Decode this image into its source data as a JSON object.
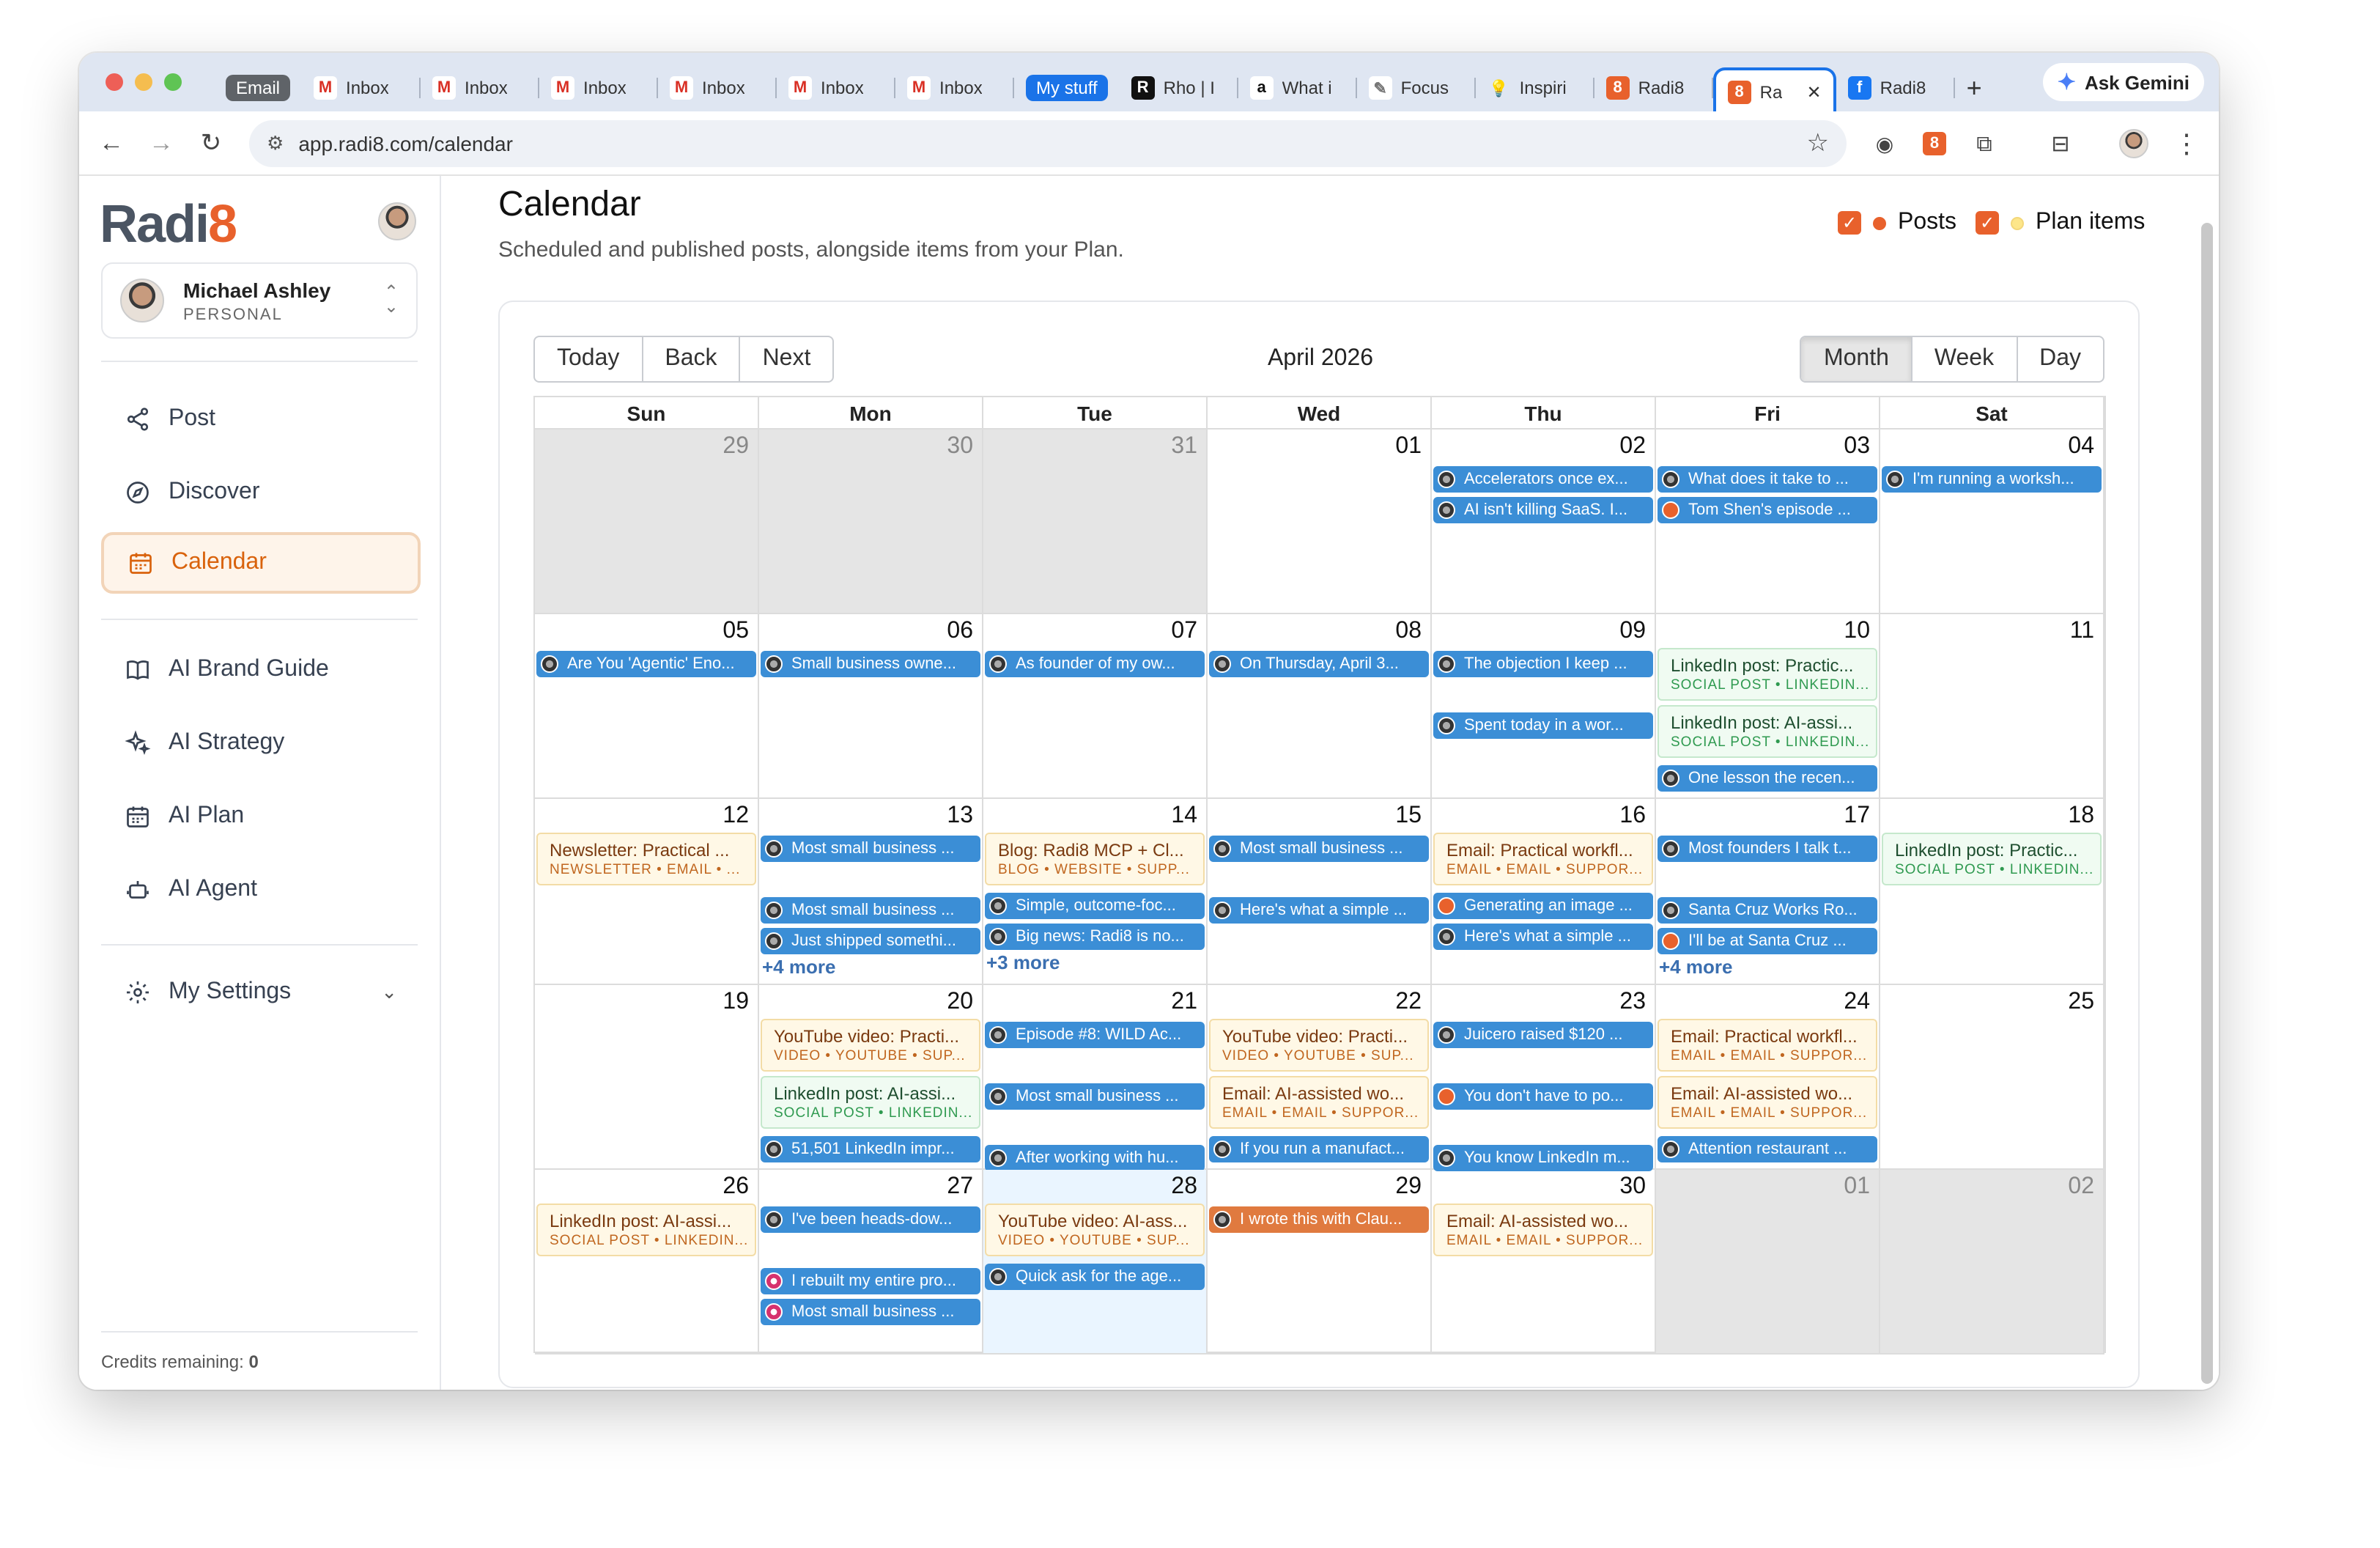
{
  "browser": {
    "tabs": [
      {
        "label": "Email",
        "kind": "group",
        "color": "#5f6368"
      },
      {
        "label": "Inbox",
        "icon": "gmail-icon"
      },
      {
        "label": "Inbox",
        "icon": "gmail-icon"
      },
      {
        "label": "Inbox",
        "icon": "gmail-icon"
      },
      {
        "label": "Inbox",
        "icon": "gmail-icon"
      },
      {
        "label": "Inbox",
        "icon": "gmail-icon"
      },
      {
        "label": "Inbox",
        "icon": "gmail-icon"
      },
      {
        "label": "My stuff",
        "kind": "group",
        "color": "#1a73e8"
      },
      {
        "label": "Rho | I",
        "icon": "rho-icon"
      },
      {
        "label": "What i",
        "icon": "amazon-icon"
      },
      {
        "label": "Focus",
        "icon": "focus-icon"
      },
      {
        "label": "Inspiri",
        "icon": "bulb-icon"
      },
      {
        "label": "Radi8",
        "icon": "radi8-icon"
      },
      {
        "label": "Ra",
        "icon": "radi8-icon",
        "active": true
      },
      {
        "label": "Radi8",
        "icon": "facebook-icon"
      }
    ],
    "ask_gemini": "Ask Gemini",
    "url": "app.radi8.com/calendar"
  },
  "sidebar": {
    "logo_prefix": "Radi",
    "logo_suffix": "8",
    "user_name": "Michael Ashley",
    "user_plan": "PERSONAL",
    "nav": [
      "Post",
      "Discover",
      "Calendar",
      "AI Brand Guide",
      "AI Strategy",
      "AI Plan",
      "AI Agent",
      "My Settings"
    ],
    "credits_label": "Credits remaining:",
    "credits_value": "0"
  },
  "page": {
    "title": "Calendar",
    "subtitle": "Scheduled and published posts, alongside items from your Plan.",
    "filter_posts": "Posts",
    "filter_plan": "Plan items",
    "colors": {
      "accent": "#e8612c",
      "post": "#3b8ed6",
      "plan_dot": "#fde68a"
    }
  },
  "calendar": {
    "nav": {
      "today": "Today",
      "back": "Back",
      "next": "Next"
    },
    "views": {
      "month": "Month",
      "week": "Week",
      "day": "Day",
      "selected": "Month"
    },
    "month_label": "April 2026",
    "weekdays": [
      "Sun",
      "Mon",
      "Tue",
      "Wed",
      "Thu",
      "Fri",
      "Sat"
    ],
    "weeks": [
      [
        {
          "d": "29",
          "off": true,
          "ev": []
        },
        {
          "d": "30",
          "off": true,
          "ev": []
        },
        {
          "d": "31",
          "off": true,
          "ev": []
        },
        {
          "d": "01",
          "ev": []
        },
        {
          "d": "02",
          "ev": [
            {
              "t": "Accelerators once ex..."
            },
            {
              "t": "AI isn't killing SaaS. I..."
            }
          ]
        },
        {
          "d": "03",
          "ev": [
            {
              "t": "What does it take to ..."
            },
            {
              "t": "Tom Shen's episode ...",
              "icon": "r8"
            }
          ]
        },
        {
          "d": "04",
          "ev": [
            {
              "t": "I'm running a worksh..."
            }
          ]
        }
      ],
      [
        {
          "d": "05",
          "ev": [
            {
              "t": "Are You 'Agentic' Eno..."
            }
          ]
        },
        {
          "d": "06",
          "ev": [
            {
              "t": "Small business owne..."
            }
          ]
        },
        {
          "d": "07",
          "ev": [
            {
              "t": "As founder of my ow..."
            }
          ]
        },
        {
          "d": "08",
          "ev": [
            {
              "t": "On Thursday, April 3..."
            }
          ]
        },
        {
          "d": "09",
          "ev": [
            {
              "t": "The objection I keep ..."
            },
            {
              "gap": true
            },
            {
              "t": "Spent today in a wor..."
            }
          ]
        },
        {
          "d": "10",
          "ev": [
            {
              "plan": "green",
              "t": "LinkedIn post: Practic...",
              "s": "SOCIAL POST • LINKEDIN..."
            },
            {
              "plan": "green",
              "t": "LinkedIn post: AI-assi...",
              "s": "SOCIAL POST • LINKEDIN..."
            },
            {
              "t": "One lesson the recen..."
            }
          ]
        },
        {
          "d": "11",
          "ev": []
        }
      ],
      [
        {
          "d": "12",
          "ev": [
            {
              "plan": "yellow",
              "t": "Newsletter: Practical ...",
              "s": "NEWSLETTER • EMAIL • ..."
            }
          ]
        },
        {
          "d": "13",
          "ev": [
            {
              "t": "Most small business ..."
            },
            {
              "gap": true
            },
            {
              "t": "Most small business ..."
            },
            {
              "t": "Just shipped somethi..."
            }
          ],
          "more": "+4 more"
        },
        {
          "d": "14",
          "ev": [
            {
              "plan": "yellow",
              "t": "Blog: Radi8 MCP + Cl...",
              "s": "BLOG • WEBSITE • SUPP..."
            },
            {
              "t": "Simple, outcome-foc..."
            },
            {
              "t": "Big news: Radi8 is no..."
            }
          ],
          "more": "+3 more"
        },
        {
          "d": "15",
          "ev": [
            {
              "t": "Most small business ..."
            },
            {
              "gap": true
            },
            {
              "t": "Here's what a simple ..."
            }
          ]
        },
        {
          "d": "16",
          "ev": [
            {
              "plan": "yellow",
              "t": "Email: Practical workfl...",
              "s": "EMAIL • EMAIL • SUPPOR..."
            },
            {
              "t": "Generating an image ...",
              "icon": "r8"
            },
            {
              "t": "Here's what a simple ..."
            }
          ]
        },
        {
          "d": "17",
          "ev": [
            {
              "t": "Most founders I talk t..."
            },
            {
              "gap": true
            },
            {
              "t": "Santa Cruz Works Ro..."
            },
            {
              "t": "I'll be at Santa Cruz ...",
              "icon": "r8"
            }
          ],
          "more": "+4 more"
        },
        {
          "d": "18",
          "ev": [
            {
              "plan": "green",
              "t": "LinkedIn post: Practic...",
              "s": "SOCIAL POST • LINKEDIN..."
            }
          ]
        }
      ],
      [
        {
          "d": "19",
          "ev": []
        },
        {
          "d": "20",
          "ev": [
            {
              "plan": "yellow",
              "t": "YouTube video: Practi...",
              "s": "VIDEO • YOUTUBE • SUP..."
            },
            {
              "plan": "green",
              "t": "LinkedIn post: AI-assi...",
              "s": "SOCIAL POST • LINKEDIN..."
            },
            {
              "t": "51,501 LinkedIn impr..."
            }
          ]
        },
        {
          "d": "21",
          "ev": [
            {
              "t": "Episode #8: WILD Ac..."
            },
            {
              "gap": true
            },
            {
              "t": "Most small business ..."
            },
            {
              "gap": true
            },
            {
              "t": "After working with hu..."
            }
          ]
        },
        {
          "d": "22",
          "ev": [
            {
              "plan": "yellow",
              "t": "YouTube video: Practi...",
              "s": "VIDEO • YOUTUBE • SUP..."
            },
            {
              "plan": "yellow",
              "t": "Email: AI-assisted wo...",
              "s": "EMAIL • EMAIL • SUPPOR..."
            },
            {
              "t": "If you run a manufact..."
            }
          ]
        },
        {
          "d": "23",
          "ev": [
            {
              "t": "Juicero raised $120 ..."
            },
            {
              "gap": true
            },
            {
              "t": "You don't have to po...",
              "icon": "r8"
            },
            {
              "gap": true
            },
            {
              "t": "You know LinkedIn m..."
            }
          ]
        },
        {
          "d": "24",
          "ev": [
            {
              "plan": "yellow",
              "t": "Email: Practical workfl...",
              "s": "EMAIL • EMAIL • SUPPOR..."
            },
            {
              "plan": "yellow",
              "t": "Email: AI-assisted wo...",
              "s": "EMAIL • EMAIL • SUPPOR..."
            },
            {
              "t": "Attention restaurant ..."
            }
          ]
        },
        {
          "d": "25",
          "ev": []
        }
      ],
      [
        {
          "d": "26",
          "ev": [
            {
              "plan": "yellow",
              "t": "LinkedIn post: AI-assi...",
              "s": "SOCIAL POST • LINKEDIN..."
            }
          ]
        },
        {
          "d": "27",
          "ev": [
            {
              "t": "I've been heads-dow..."
            },
            {
              "gap": true
            },
            {
              "t": "I rebuilt my entire pro...",
              "icon": "ig"
            },
            {
              "t": "Most small business ...",
              "icon": "ig"
            }
          ]
        },
        {
          "d": "28",
          "today": true,
          "ev": [
            {
              "plan": "yellow",
              "t": "YouTube video: AI-ass...",
              "s": "VIDEO • YOUTUBE • SUP..."
            },
            {
              "t": "Quick ask for the age..."
            }
          ]
        },
        {
          "d": "29",
          "ev": [
            {
              "t": "I wrote this with Clau...",
              "dark": true
            }
          ]
        },
        {
          "d": "30",
          "ev": [
            {
              "plan": "yellow",
              "t": "Email: AI-assisted wo...",
              "s": "EMAIL • EMAIL • SUPPOR..."
            }
          ]
        },
        {
          "d": "01",
          "off": true,
          "ev": []
        },
        {
          "d": "02",
          "off": true,
          "ev": []
        }
      ]
    ]
  }
}
